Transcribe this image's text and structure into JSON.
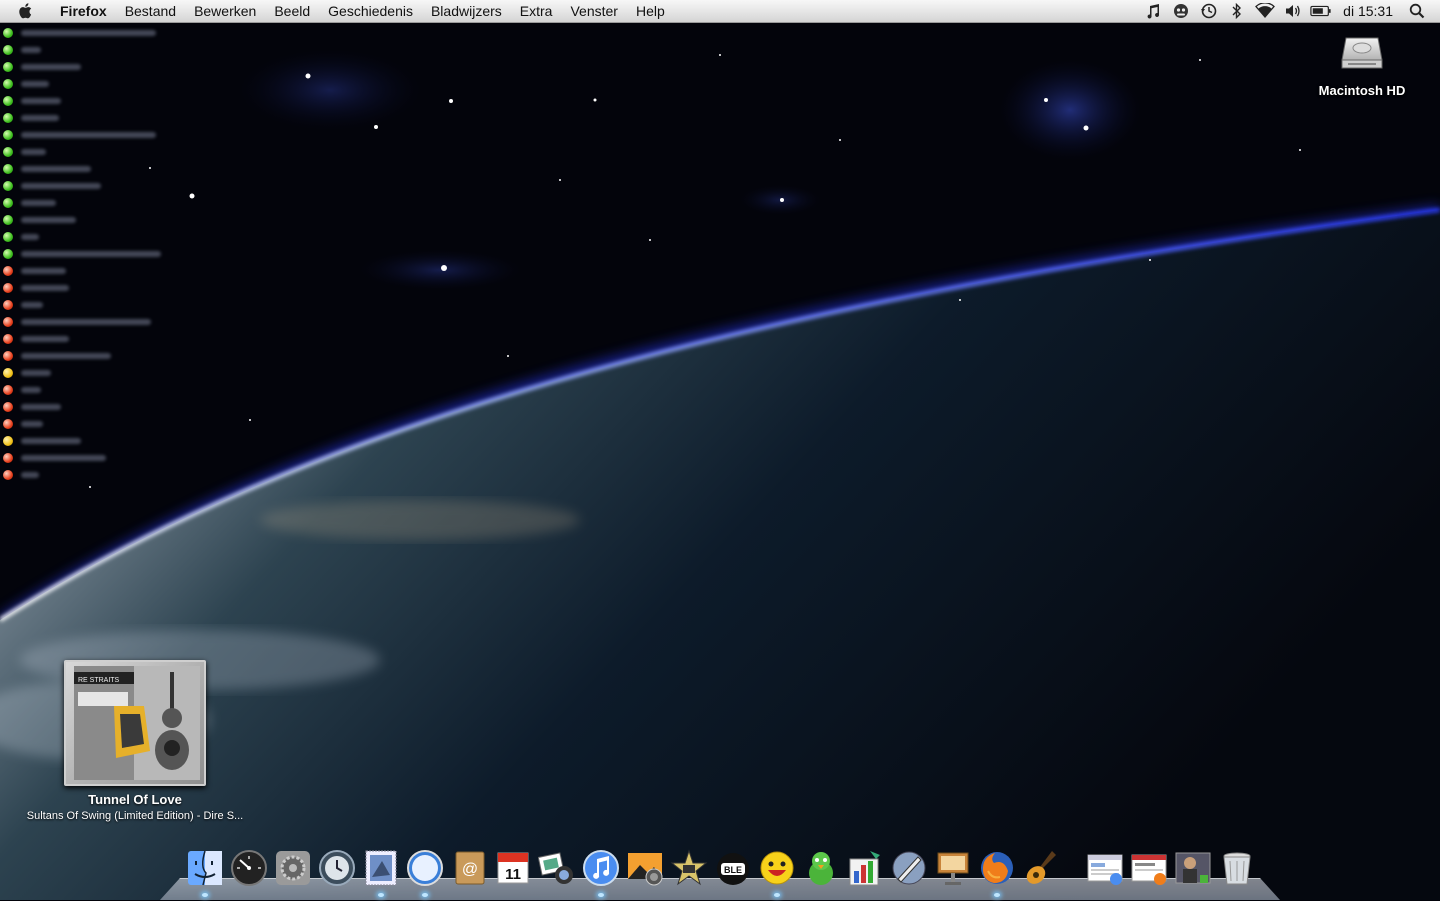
{
  "menubar": {
    "app_name": "Firefox",
    "menus": [
      "Bestand",
      "Bewerken",
      "Beeld",
      "Geschiedenis",
      "Bladwijzers",
      "Extra",
      "Venster",
      "Help"
    ],
    "status_icons": [
      "itunes-note-icon",
      "skype-icon",
      "time-machine-icon",
      "bluetooth-icon",
      "wifi-icon",
      "volume-icon",
      "battery-icon"
    ],
    "clock": "di 15:31",
    "spotlight": "spotlight-icon"
  },
  "desktop": {
    "disk_label": "Macintosh HD"
  },
  "buddy_list": {
    "statuses": [
      "online",
      "online",
      "online",
      "online",
      "online",
      "online",
      "online",
      "online",
      "online",
      "online",
      "online",
      "online",
      "online",
      "online",
      "offline",
      "offline",
      "offline",
      "offline",
      "offline",
      "offline",
      "away",
      "offline",
      "offline",
      "offline",
      "away",
      "offline",
      "offline"
    ]
  },
  "now_playing": {
    "song": "Tunnel Of Love",
    "album_artist": "Sultans Of Swing (Limited Edition) - Dire S...",
    "cover_text": "RE STRAITS"
  },
  "dock": {
    "apps": [
      "finder",
      "dashboard",
      "system-preferences",
      "time-machine",
      "mail-stamp",
      "safari",
      "address-book",
      "ical",
      "iphoto",
      "itunes",
      "image-capture",
      "imovie",
      "bible",
      "yahoo-messenger",
      "adium",
      "omnigraph",
      "script-editor",
      "keynote",
      "firefox",
      "garageband"
    ],
    "running": [
      "finder",
      "mail-stamp",
      "safari",
      "itunes",
      "yahoo-messenger",
      "firefox"
    ],
    "docs": [
      "stack-downloads",
      "stack-browser",
      "user-folder"
    ],
    "trash": "trash"
  }
}
